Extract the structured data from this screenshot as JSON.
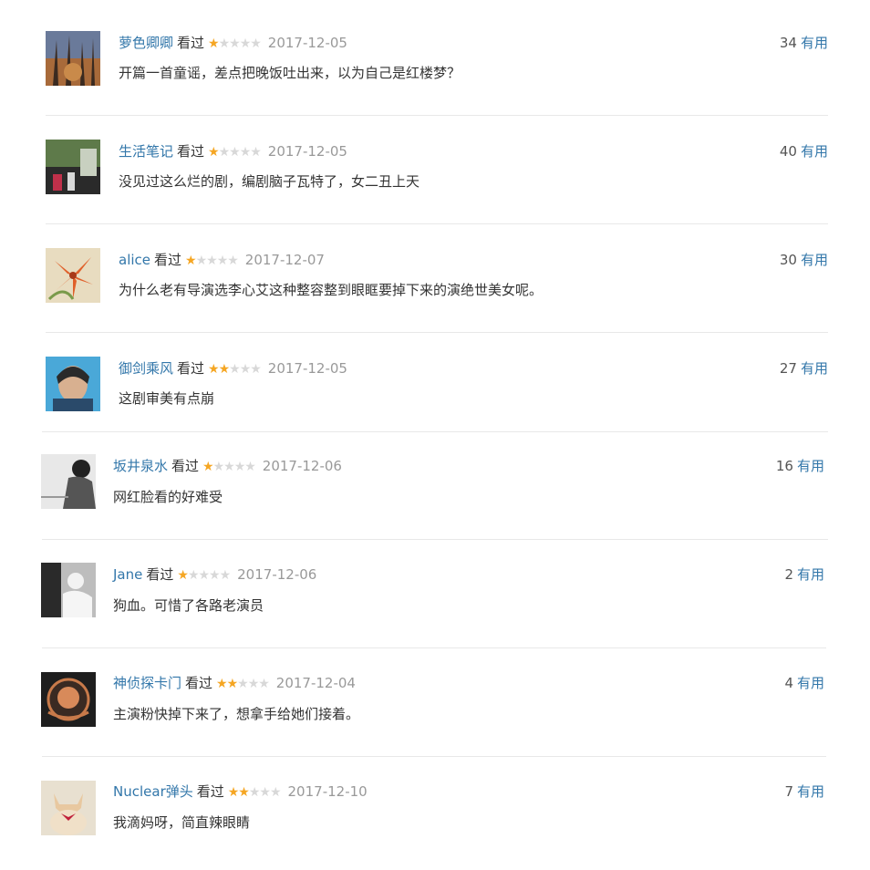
{
  "comments": [
    {
      "author": "萝色卿卿",
      "status": "看过",
      "rating": 1,
      "date": "2017-12-05",
      "text": "开篇一首童谣，差点把晚饭吐出来，以为自己是红楼梦？",
      "votes": "34",
      "votes_label": "有用",
      "avatar_icon": "forest-photo-avatar"
    },
    {
      "author": "生活笔记",
      "status": "看过",
      "rating": 1,
      "date": "2017-12-05",
      "text": "没见过这么烂的剧，编剧脑子瓦特了，女二丑上天",
      "votes": "40",
      "votes_label": "有用",
      "avatar_icon": "room-photo-avatar"
    },
    {
      "author": "alice",
      "status": "看过",
      "rating": 1,
      "date": "2017-12-07",
      "text": "为什么老有导演选李心艾这种整容整到眼眶要掉下来的演绝世美女呢。",
      "votes": "30",
      "votes_label": "有用",
      "avatar_icon": "lily-flower-avatar"
    },
    {
      "author": "御剑乘风",
      "status": "看过",
      "rating": 2,
      "date": "2017-12-05",
      "text": "这剧审美有点崩",
      "votes": "27",
      "votes_label": "有用",
      "avatar_icon": "portrait-avatar"
    },
    {
      "author": "坂井泉水",
      "status": "看过",
      "rating": 1,
      "date": "2017-12-06",
      "text": "网红脸看的好难受",
      "votes": "16",
      "votes_label": "有用",
      "avatar_icon": "bw-person-avatar"
    },
    {
      "author": "Jane",
      "status": "看过",
      "rating": 1,
      "date": "2017-12-06",
      "text": "狗血。可惜了各路老演员",
      "votes": "2",
      "votes_label": "有用",
      "avatar_icon": "bw-figure-avatar"
    },
    {
      "author": "神侦探卡门",
      "status": "看过",
      "rating": 2,
      "date": "2017-12-04",
      "text": "主演粉快掉下来了，想拿手给她们接着。",
      "votes": "4",
      "votes_label": "有用",
      "avatar_icon": "badge-avatar"
    },
    {
      "author": "Nuclear弹头",
      "status": "看过",
      "rating": 2,
      "date": "2017-12-10",
      "text": "我滴妈呀，简直辣眼睛",
      "votes": "7",
      "votes_label": "有用",
      "avatar_icon": "cat-avatar"
    }
  ],
  "colors": {
    "author": "#3377aa",
    "star_on": "#f5a623",
    "star_off": "#d8d8d8",
    "date": "#999999"
  }
}
